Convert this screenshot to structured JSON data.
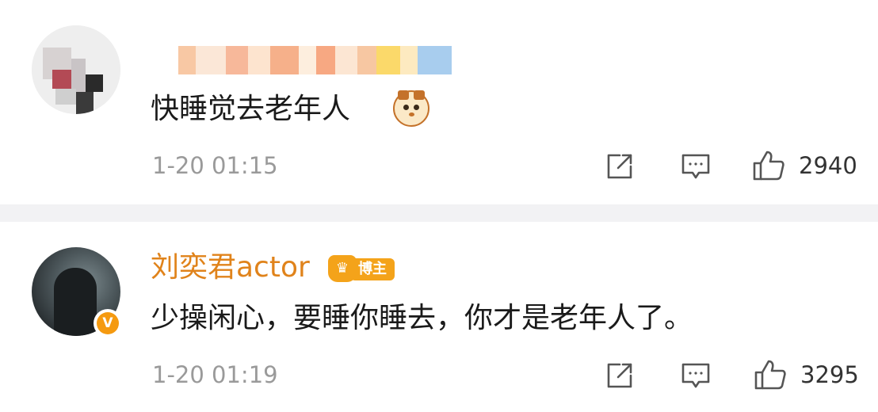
{
  "comments": [
    {
      "username": "",
      "text": "快睡觉去老年人",
      "emoji": "cat-face-icon",
      "time": "1-20 01:15",
      "likes": "2940",
      "avatar": "pixelated-avatar"
    },
    {
      "username": "刘奕君actor",
      "badge": "博主",
      "text": "少操闲心，要睡你睡去，你才是老年人了。",
      "time": "1-20 01:19",
      "likes": "3295",
      "avatar": "photo-avatar",
      "verified": "V"
    }
  ],
  "icons": {
    "share": "share-icon",
    "comment": "comment-icon",
    "like": "thumbs-up-icon"
  },
  "colors": {
    "username": "#e0831b",
    "badge": "#f4a31a",
    "meta": "#9a9a9a",
    "separator": "#f2f2f4"
  }
}
